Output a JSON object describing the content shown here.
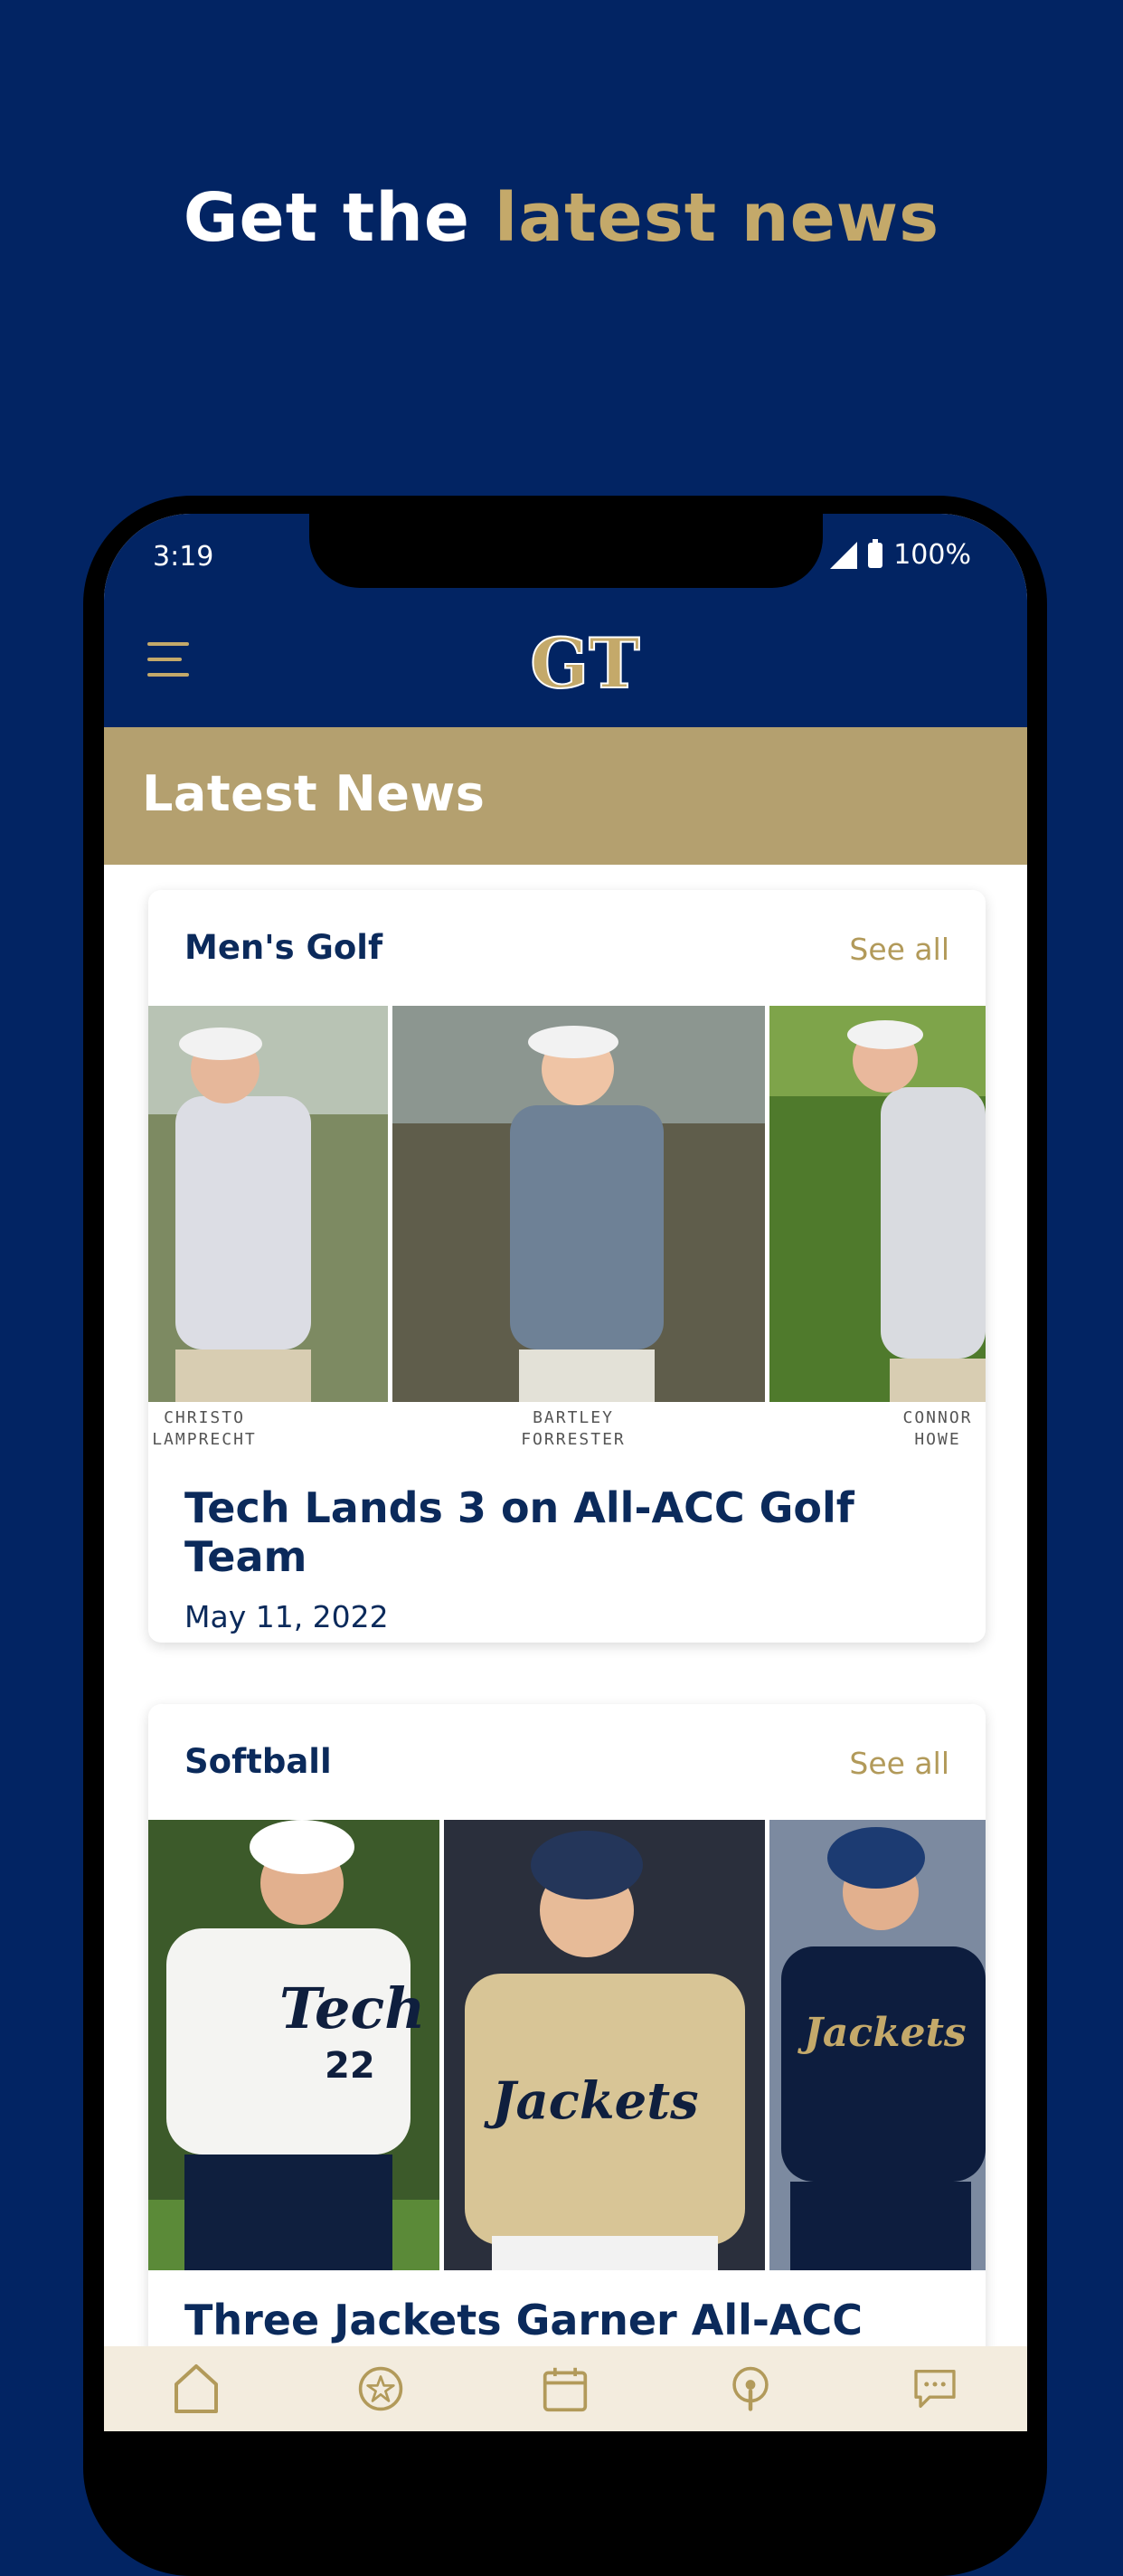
{
  "promo": {
    "headline_white": "Get the ",
    "headline_gold": "latest news"
  },
  "status_bar": {
    "time": "3:19",
    "battery": "100%"
  },
  "app_bar": {
    "logo_text": "GT"
  },
  "page": {
    "title": "Latest News"
  },
  "cards": [
    {
      "sport": "Men's Golf",
      "see_all": "See all",
      "image_captions": [
        "CHRISTO LAMPRECHT",
        "BARTLEY FORRESTER",
        "CONNOR HOWE"
      ],
      "article_title": "Tech Lands 3 on All-ACC Golf Team",
      "date": "May 11, 2022"
    },
    {
      "sport": "Softball",
      "see_all": "See all",
      "image_text": [
        "Tech",
        "22",
        "Jackets",
        "Jackets"
      ],
      "article_title": "Three Jackets Garner All-ACC"
    }
  ],
  "bottom_nav": [
    "home-icon",
    "star-icon",
    "calendar-icon",
    "podcast-icon",
    "chat-icon"
  ],
  "colors": {
    "navy": "#022463",
    "gold": "#c4a96a",
    "banner_gold": "#b4a06f"
  }
}
